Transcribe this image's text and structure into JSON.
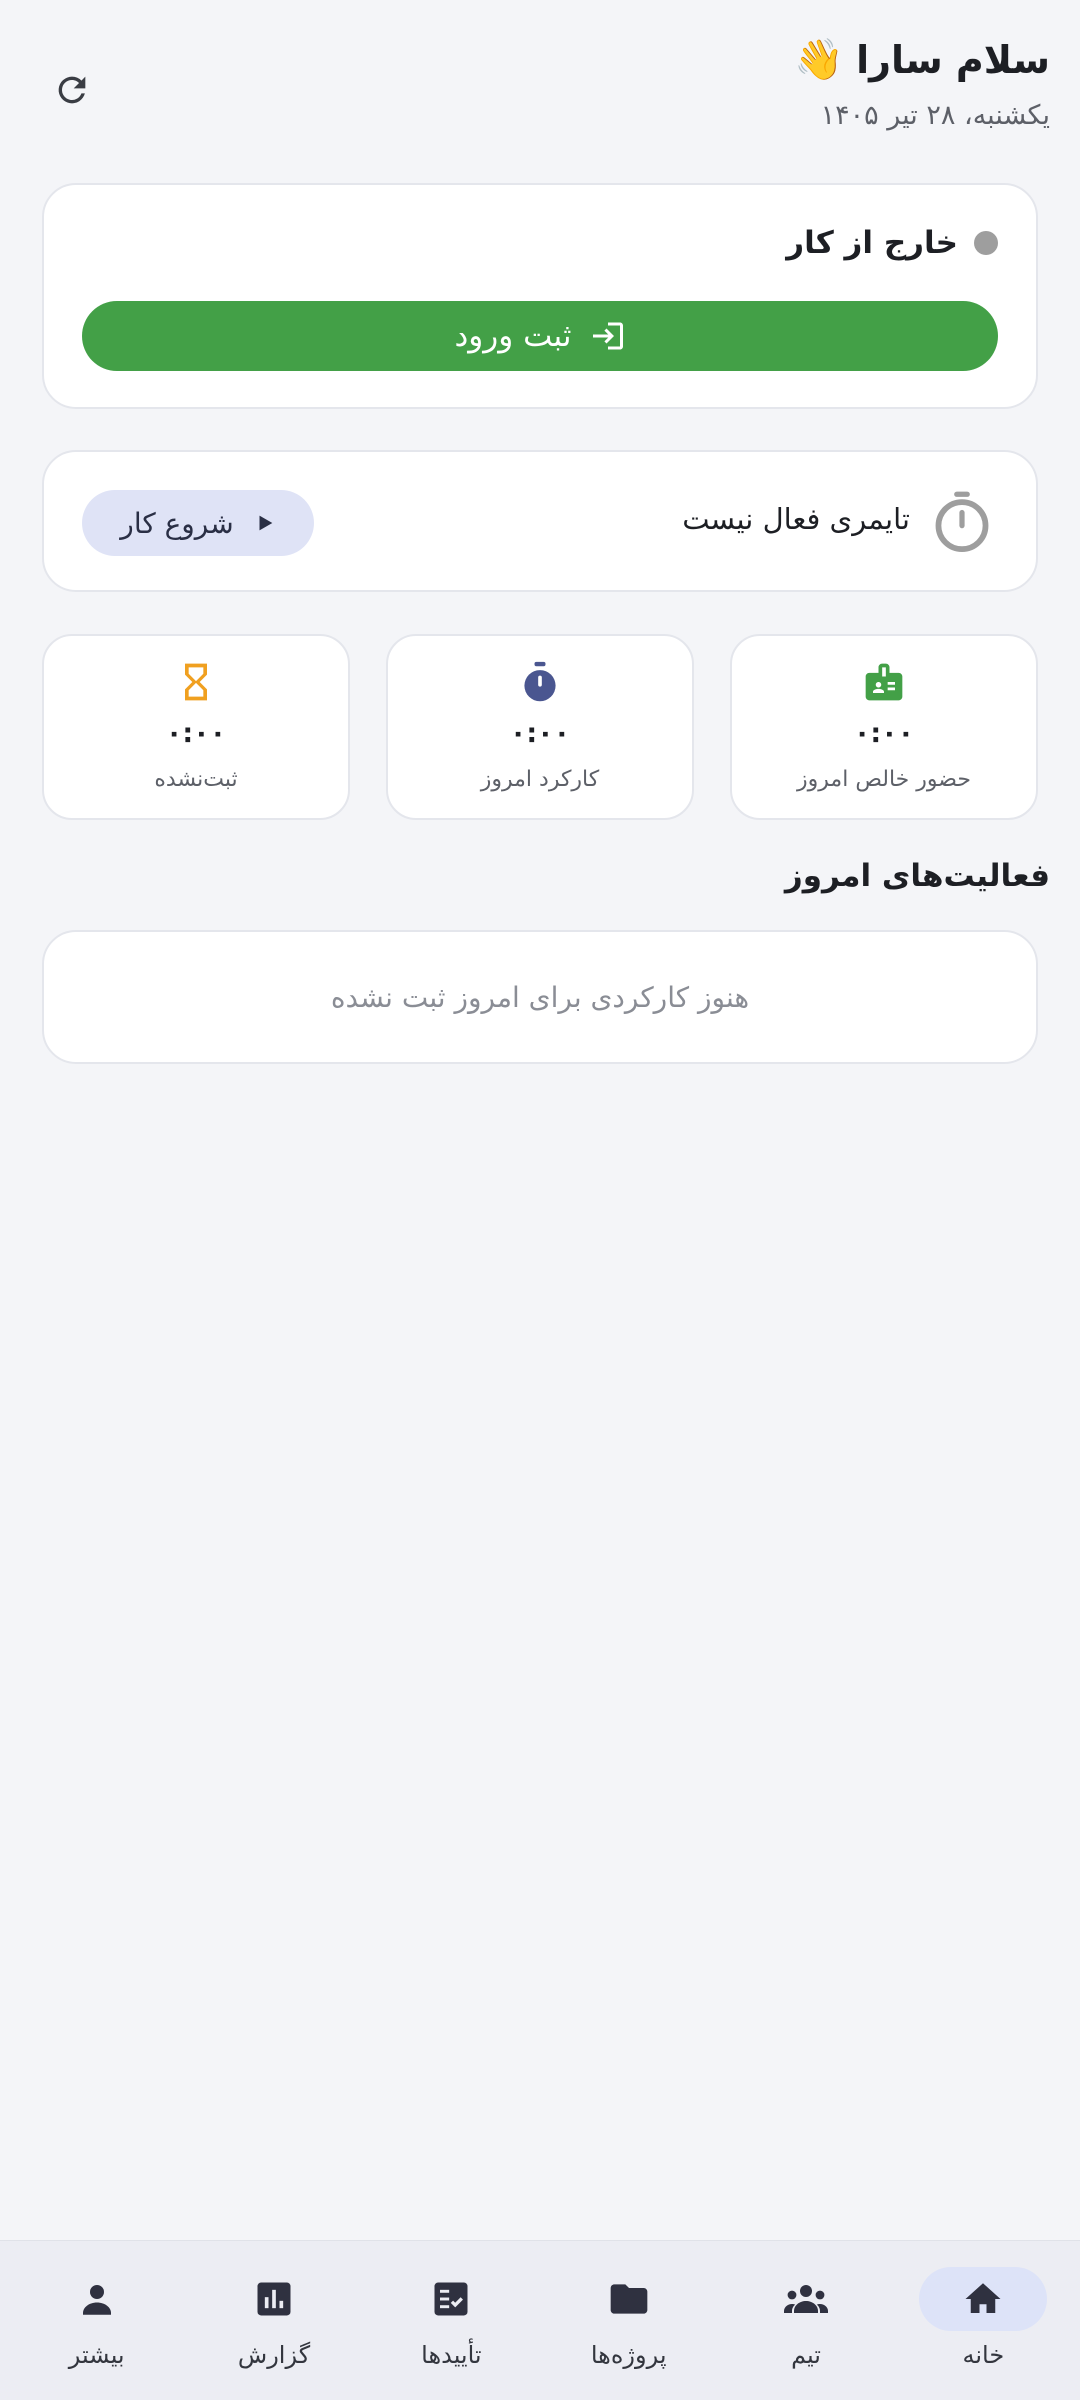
{
  "header": {
    "greeting": "سلام سارا",
    "wave_emoji": "👋",
    "date": "یکشنبه، ۲۸ تیر ۱۴۰۵",
    "refresh_icon": "refresh-icon"
  },
  "status_card": {
    "status_label": "خارج از کار",
    "status_color": "#9e9e9e",
    "checkin_label": "ثبت ورود",
    "checkin_color": "#43a047"
  },
  "timer_card": {
    "text": "تایمری فعال نیست",
    "start_label": "شروع کار"
  },
  "stats": [
    {
      "label": "حضور خالص امروز",
      "value": "۰:۰۰",
      "icon": "badge-icon",
      "color": "#43a047"
    },
    {
      "label": "کارکرد امروز",
      "value": "۰:۰۰",
      "icon": "stopwatch-icon",
      "color": "#4a5690"
    },
    {
      "label": "ثبت‌نشده",
      "value": "۰:۰۰",
      "icon": "hourglass-icon",
      "color": "#f0a020"
    }
  ],
  "activities": {
    "title": "فعالیت‌های امروز",
    "empty_text": "هنوز کارکردی برای امروز ثبت نشده"
  },
  "nav": [
    {
      "label": "خانه",
      "icon": "home-icon",
      "active": true
    },
    {
      "label": "تیم",
      "icon": "team-icon",
      "active": false
    },
    {
      "label": "پروژه‌ها",
      "icon": "folder-icon",
      "active": false
    },
    {
      "label": "تأییدها",
      "icon": "approvals-icon",
      "active": false
    },
    {
      "label": "گزارش",
      "icon": "report-icon",
      "active": false
    },
    {
      "label": "بیشتر",
      "icon": "person-icon",
      "active": false
    }
  ]
}
